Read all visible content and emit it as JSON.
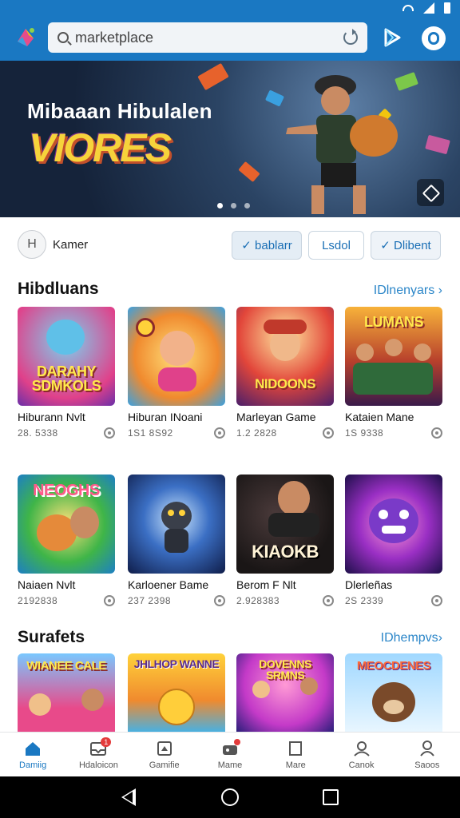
{
  "search": {
    "placeholder": "marketplace"
  },
  "banner": {
    "title": "Mibaaan Hibulalen",
    "logo_text": "VIORES",
    "page_count": 3,
    "active_page": 1
  },
  "filter": {
    "avatar_letter": "H",
    "name": "Kamer",
    "chips": [
      "✓ bablarr",
      "Lsdol",
      "✓ Dlibent"
    ]
  },
  "section1": {
    "title": "Hibdluans",
    "link": "IDlnenyars ›",
    "games": [
      {
        "thumb_text": "DARAHY SDMKOLS",
        "title": "Hiburann Nvlt",
        "sub": "28. 5338",
        "icon": "download-icon"
      },
      {
        "thumb_text": "",
        "title": "Hiburan INoani",
        "sub": "1S1 8S92",
        "icon": "download-icon"
      },
      {
        "thumb_text": "NIDOONS",
        "title": "Marleyan Game",
        "sub": "1.2 2828",
        "icon": "download-icon"
      },
      {
        "thumb_text": "LUMANS",
        "title": "Kataien Mane",
        "sub": "1S 9338",
        "icon": "download-icon"
      }
    ]
  },
  "section2": {
    "games": [
      {
        "thumb_text": "NEOGHS",
        "title": "Naiaen Nvlt",
        "sub": "2192838",
        "icon": "download-icon"
      },
      {
        "thumb_text": "",
        "title": "Karloener Bame",
        "sub": "237 2398",
        "icon": "download-icon"
      },
      {
        "thumb_text": "KIAOKB",
        "title": "Berom F Nlt",
        "sub": "2.928383",
        "icon": "download-icon"
      },
      {
        "thumb_text": "",
        "title": "Dlerleñas",
        "sub": "2S 2339",
        "icon": "download-icon"
      }
    ]
  },
  "section3": {
    "title": "Surafets",
    "link": "IDhempvs›",
    "games": [
      {
        "thumb_text": "WIANEE CALE"
      },
      {
        "thumb_text": "JHLHOP WANNE"
      },
      {
        "thumb_text": "DOVENNS SRMNS"
      },
      {
        "thumb_text": "MEOCDENES"
      }
    ]
  },
  "bottom_nav": [
    {
      "label": "Damiig",
      "icon": "home-icon",
      "active": true
    },
    {
      "label": "Hdaloicon",
      "icon": "inbox-icon",
      "badge": "1"
    },
    {
      "label": "Gamifie",
      "icon": "game-icon"
    },
    {
      "label": "Mame",
      "icon": "games-icon",
      "dot": true
    },
    {
      "label": "Mare",
      "icon": "bookmark-icon"
    },
    {
      "label": "Canok",
      "icon": "account-icon"
    },
    {
      "label": "Saoos",
      "icon": "person-icon"
    }
  ],
  "colors": {
    "accent": "#1a78c2",
    "header": "#1a78c2",
    "link": "#2b86c8"
  }
}
